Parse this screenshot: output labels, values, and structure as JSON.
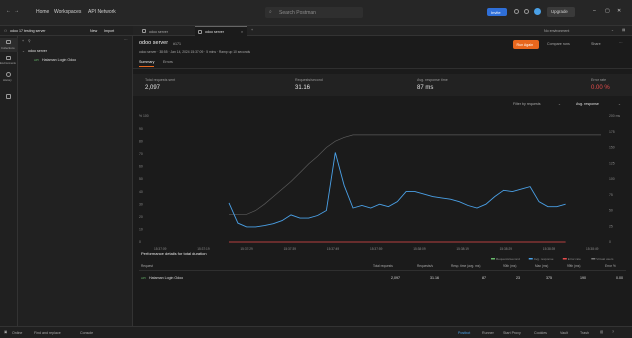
{
  "topbar": {
    "nav": [
      "Home",
      "Workspaces",
      "API Network"
    ],
    "search_placeholder": "Search Postman",
    "invite_label": "Invite",
    "upgrade_label": "Upgrade"
  },
  "workspace": {
    "name": "odoo 17 testing server",
    "new_label": "New",
    "import_label": "Import"
  },
  "sidebar": {
    "items": [
      "Collections",
      "Environments",
      "History"
    ]
  },
  "tree": {
    "collection": "odoo server",
    "request_method": "API",
    "request_name": "Hataman Login Odoo"
  },
  "tabs": [
    {
      "label": "odoo server"
    },
    {
      "label": "odoo server"
    }
  ],
  "env": {
    "label": "No environment"
  },
  "runner": {
    "title": "odoo server",
    "run_id": "#171",
    "meta": "odoo server · 38:55 · Jan 14, 2024 15:37:09 · 5 mins · Ramp up 10 seconds",
    "run_again": "Run Again",
    "compare": "Compare runs",
    "share": "Share",
    "subtabs": [
      "Summary",
      "Errors"
    ]
  },
  "stats": [
    {
      "label": "Total requests sent",
      "value": "2,097"
    },
    {
      "label": "Requests/second",
      "value": "31.16"
    },
    {
      "label": "Avg. response time",
      "value": "87 ms"
    },
    {
      "label": "Error rate",
      "value": "0.00 %"
    }
  ],
  "filter": {
    "label": "Filter by requests",
    "metric": "Avg. response"
  },
  "chart_data": {
    "type": "line",
    "x": [
      "15:37:09",
      "15:37:19",
      "15:37:29",
      "15:37:39",
      "15:37:49",
      "15:37:59",
      "15:38:09",
      "15:38:19",
      "15:38:29",
      "15:38:39",
      "15:38:49"
    ],
    "y_left_label": "%",
    "y_left_ticks": [
      "100",
      "90",
      "80",
      "70",
      "60",
      "50",
      "40",
      "30",
      "20",
      "10",
      "0"
    ],
    "y_right_label": "ms",
    "y_right_ticks": [
      "200",
      "175",
      "150",
      "125",
      "100",
      "75",
      "50",
      "25",
      "0"
    ],
    "ylim_left": [
      0,
      100
    ],
    "ylim_right": [
      0,
      200
    ],
    "series": [
      {
        "name": "Virtual users",
        "color": "#5a5a5a",
        "axis": "left",
        "x": [
          0,
          1,
          2,
          3,
          4,
          5,
          6,
          7,
          8,
          9,
          10,
          11,
          12,
          13,
          14,
          15,
          16,
          17,
          18,
          19,
          20,
          21,
          22,
          23,
          24,
          25,
          26,
          27,
          28,
          29,
          30,
          31,
          32,
          33,
          34,
          35,
          36,
          37,
          38,
          39,
          40,
          41,
          42
        ],
        "y": [
          22,
          22,
          22,
          25,
          30,
          36,
          42,
          48,
          55,
          62,
          68,
          75,
          80,
          83,
          85,
          85,
          85,
          85,
          85,
          85,
          85,
          85,
          85,
          85,
          85,
          85,
          85,
          85,
          85,
          85,
          85,
          85,
          85,
          85,
          85,
          85,
          85,
          85,
          85,
          85,
          85,
          85,
          85
        ]
      },
      {
        "name": "Avg. response",
        "color": "#4aa0e6",
        "axis": "right",
        "x": [
          0,
          1,
          2,
          3,
          4,
          5,
          6,
          7,
          8,
          9,
          10,
          11,
          12,
          13,
          14,
          15,
          16,
          17,
          18,
          19,
          20,
          21,
          22,
          23,
          24,
          25,
          26,
          27,
          28,
          29,
          30,
          31,
          32,
          33,
          34,
          35,
          36,
          37,
          38
        ],
        "y": [
          62,
          30,
          24,
          24,
          26,
          29,
          34,
          43,
          38,
          38,
          42,
          50,
          142,
          90,
          54,
          58,
          54,
          60,
          56,
          64,
          80,
          80,
          76,
          72,
          70,
          68,
          64,
          58,
          54,
          60,
          72,
          82,
          80,
          84,
          88,
          64,
          56,
          56,
          60
        ]
      },
      {
        "name": "Error rate",
        "color": "#e84c4c",
        "axis": "left",
        "x": [
          0,
          38
        ],
        "y": [
          0,
          0
        ]
      }
    ],
    "legend": [
      "Requests/second",
      "Avg. response",
      "Error rate",
      "Virtual users"
    ]
  },
  "perf": {
    "title": "Performance details for total duration",
    "columns": [
      "Request",
      "Total requests",
      "Requests/s",
      "Resp. time (avg. ms)",
      "90th (ms)",
      "Max (ms)",
      "99th (ms)",
      "Error %"
    ],
    "rows": [
      {
        "method": "API",
        "name": "Hataman Login Odoo",
        "total": "2,097",
        "rps": "31.16",
        "avg": "87",
        "p90": "23",
        "max": "375",
        "p99": "190",
        "err": "0.00"
      }
    ]
  },
  "statusbar": {
    "left": [
      "Online",
      "Find and replace",
      "Console"
    ],
    "right": [
      "Postbot",
      "Runner",
      "Start Proxy",
      "Cookies",
      "Vault",
      "Trash"
    ]
  }
}
